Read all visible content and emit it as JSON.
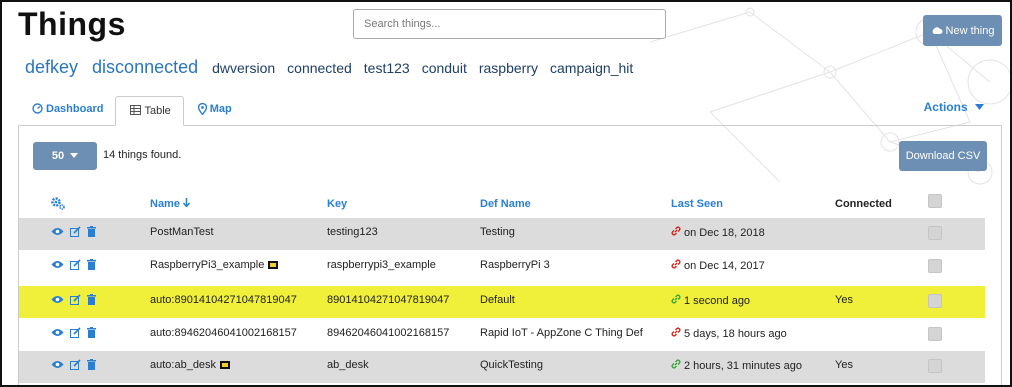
{
  "header": {
    "title": "Things",
    "search_placeholder": "Search things...",
    "new_button_label": "New thing"
  },
  "tags": [
    "defkey",
    "disconnected",
    "dwversion",
    "connected",
    "test123",
    "conduit",
    "raspberry",
    "campaign_hit"
  ],
  "tabs": [
    {
      "label": "Dashboard",
      "icon": "dashboard-icon"
    },
    {
      "label": "Table",
      "icon": "table-icon"
    },
    {
      "label": "Map",
      "icon": "map-marker-icon"
    }
  ],
  "actions_label": "Actions",
  "toolbar": {
    "page_size": "50",
    "found_text": "14 things found.",
    "download_label": "Download CSV"
  },
  "columns": {
    "name": "Name",
    "key": "Key",
    "def_name": "Def Name",
    "last_seen": "Last Seen",
    "connected": "Connected"
  },
  "rows": [
    {
      "name": "PostManTest",
      "key": "testing123",
      "def_name": "Testing",
      "last_seen": "on Dec 18, 2018",
      "connected": "",
      "status": "offline",
      "badge": false
    },
    {
      "name": "RaspberryPi3_example",
      "key": "raspberrypi3_example",
      "def_name": "RaspberryPi 3",
      "last_seen": "on Dec 14, 2017",
      "connected": "",
      "status": "offline",
      "badge": true
    },
    {
      "name": "auto:89014104271047819047",
      "key": "89014104271047819047",
      "def_name": "Default",
      "last_seen": "1 second ago",
      "connected": "Yes",
      "status": "online",
      "badge": false
    },
    {
      "name": "auto:89462046041002168157",
      "key": "89462046041002168157",
      "def_name": "Rapid IoT - AppZone C Thing Def",
      "last_seen": "5 days, 18 hours ago",
      "connected": "",
      "status": "offline",
      "badge": false
    },
    {
      "name": "auto:ab_desk",
      "key": "ab_desk",
      "def_name": "QuickTesting",
      "last_seen": "2 hours, 31 minutes ago",
      "connected": "Yes",
      "status": "online",
      "badge": true
    }
  ],
  "colors": {
    "accent": "#2a7fd4",
    "button": "#6d8fb3",
    "highlight_row": "#f0f03a",
    "online": "#3aa53a",
    "offline": "#d9241c"
  }
}
